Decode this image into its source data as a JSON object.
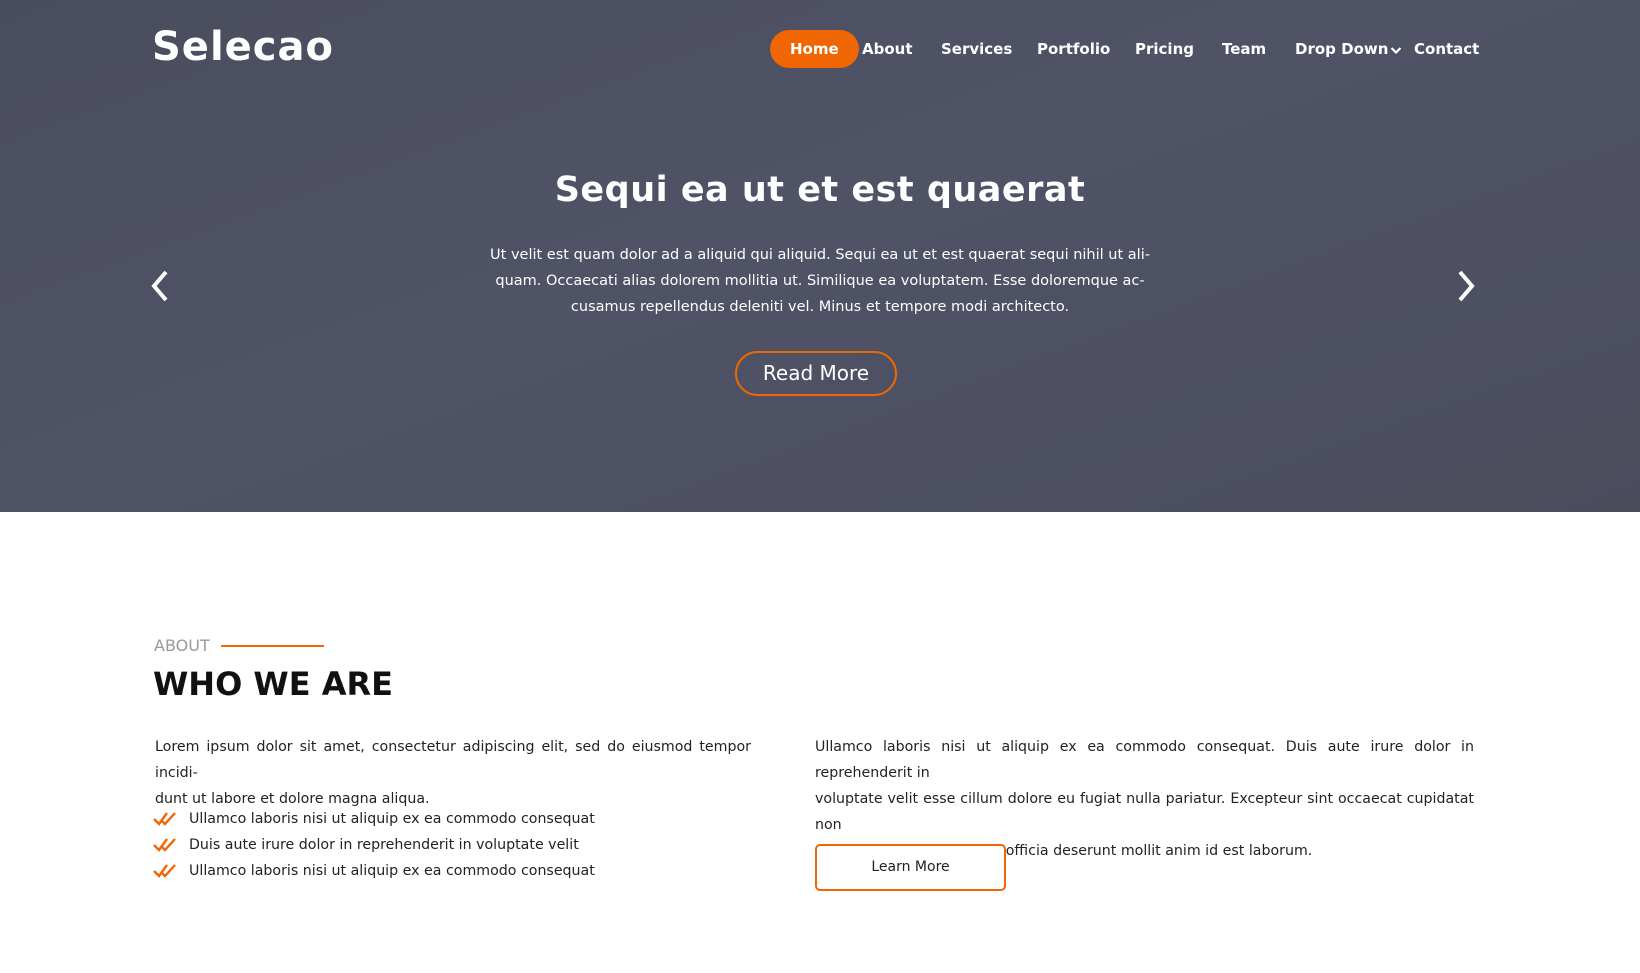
{
  "brand": {
    "logo": "Selecao",
    "accent_color": "#ef6603"
  },
  "nav": {
    "items": [
      {
        "label": "Home",
        "active": true
      },
      {
        "label": "About"
      },
      {
        "label": "Services"
      },
      {
        "label": "Portfolio"
      },
      {
        "label": "Pricing"
      },
      {
        "label": "Team"
      },
      {
        "label": "Drop Down",
        "icon": "chevron-down-icon"
      },
      {
        "label": "Contact"
      }
    ]
  },
  "hero": {
    "title": "Sequi ea ut et est quaerat",
    "text_lines": [
      "Ut velit est quam dolor ad a aliquid qui aliquid. Sequi ea ut et est quaerat sequi nihil ut ali-",
      "quam. Occaecati alias dolorem mollitia ut. Similique ea voluptatem. Esse doloremque ac-",
      "cusamus repellendus deleniti vel. Minus et tempore modi architecto."
    ],
    "button_label": "Read More",
    "prev_icon": "chevron-left-icon",
    "next_icon": "chevron-right-icon"
  },
  "about": {
    "kicker": "ABOUT",
    "title": "WHO WE ARE",
    "lead_lines": [
      "Lorem ipsum dolor sit amet, consectetur adipiscing elit, sed do eiusmod tempor incidi-",
      "dunt ut labore et dolore magna aliqua."
    ],
    "checklist": [
      "Ullamco laboris nisi ut aliquip ex ea commodo consequat",
      "Duis aute irure dolor in reprehenderit in voluptate velit",
      "Ullamco laboris nisi ut aliquip ex ea commodo consequat"
    ],
    "check_icon": "double-check-icon",
    "right_text_lines": [
      "Ullamco laboris nisi ut aliquip ex ea commodo consequat. Duis aute irure dolor in reprehenderit in",
      "voluptate velit esse cillum dolore eu fugiat nulla pariatur. Excepteur sint occaecat cupidatat non",
      "proident, sunt in culpa qui officia deserunt mollit anim id est laborum."
    ],
    "button_label": "Learn More"
  }
}
